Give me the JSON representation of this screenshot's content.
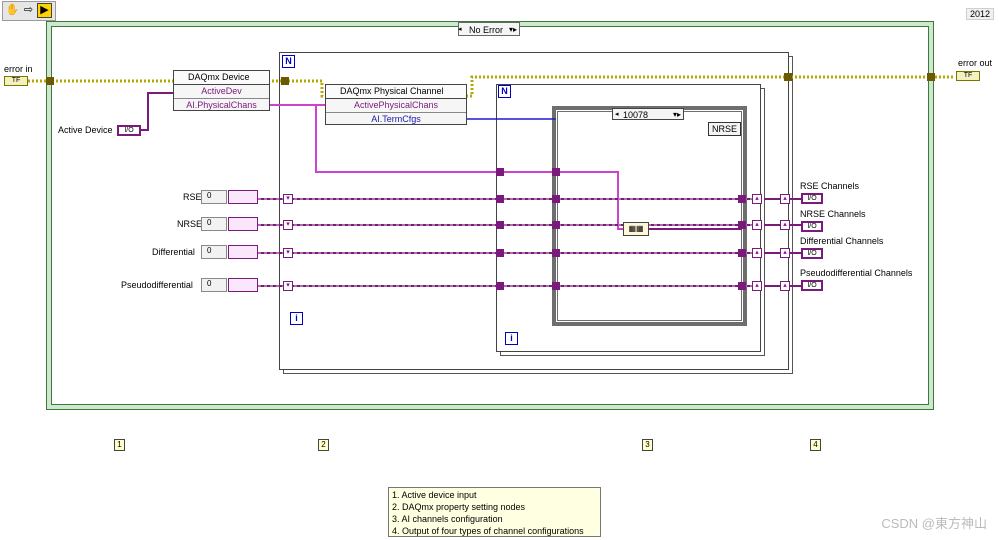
{
  "toolbar": {
    "icons": [
      "hand-icon",
      "arrow-icon",
      "run-icon"
    ],
    "hand": "✋",
    "arrow": "⇨",
    "run": "▶"
  },
  "version": "2012",
  "case_selector": {
    "value": "No Error"
  },
  "inner_case_selector": {
    "value": "10078"
  },
  "nrse_label": "NRSE",
  "for_terminal_n": "N",
  "for_terminal_i": "i",
  "nodes": {
    "device": {
      "header": "DAQmx Device",
      "rows": [
        "ActiveDev",
        "AI.PhysicalChans"
      ]
    },
    "channel": {
      "header": "DAQmx Physical Channel",
      "rows": [
        "ActivePhysicalChans",
        "AI.TermCfgs"
      ]
    }
  },
  "controls": {
    "error_in": "error in",
    "error_out": "error out",
    "active_device": "Active Device",
    "inputs": [
      {
        "label": "RSE",
        "value": "0"
      },
      {
        "label": "NRSE",
        "value": "0"
      },
      {
        "label": "Differential",
        "value": "0"
      },
      {
        "label": "Pseudodifferential",
        "value": "0"
      }
    ],
    "outputs": [
      "RSE Channels",
      "NRSE Channels",
      "Differential Channels",
      "Pseudodifferential Channels"
    ],
    "io_glyph": "I/O",
    "err_glyph": "TF"
  },
  "markers": [
    "1",
    "2",
    "3",
    "4"
  ],
  "legend": [
    "1. Active device input",
    "2. DAQmx property setting nodes",
    "3. AI channels configuration",
    "4. Output of four types of channel configurations"
  ],
  "watermark": "CSDN @東方神山",
  "colors": {
    "error_wire": "#b5a800",
    "string_wire": "#cc44cc",
    "class_wire": "#7a1a7a",
    "enum_wire": "#1a1ad0",
    "while_border": "#3a7a3a"
  }
}
